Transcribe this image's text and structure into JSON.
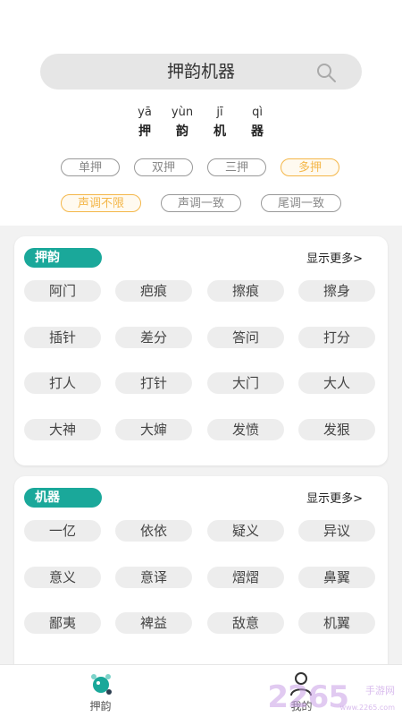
{
  "search": {
    "query": "押韵机器"
  },
  "pinyin": [
    {
      "py": "yā",
      "hz": "押"
    },
    {
      "py": "yùn",
      "hz": "韵"
    },
    {
      "py": "jī",
      "hz": "机"
    },
    {
      "py": "qì",
      "hz": "器"
    }
  ],
  "filters": {
    "rhyme_type": [
      "单押",
      "双押",
      "三押",
      "多押"
    ],
    "rhyme_type_selected": "多押",
    "tone": [
      "声调不限",
      "声调一致",
      "尾调一致"
    ],
    "tone_selected": "声调不限"
  },
  "cards": [
    {
      "tag": "押韵",
      "more": "显示更多>",
      "words": [
        "阿门",
        "疤痕",
        "擦痕",
        "擦身",
        "插针",
        "差分",
        "答问",
        "打分",
        "打人",
        "打针",
        "大门",
        "大人",
        "大神",
        "大婶",
        "发愤",
        "发狠"
      ]
    },
    {
      "tag": "机器",
      "more": "显示更多>",
      "words": [
        "一亿",
        "依依",
        "疑义",
        "异议",
        "意义",
        "意译",
        "熠熠",
        "鼻翼",
        "鄙夷",
        "裨益",
        "敌意",
        "机翼"
      ]
    }
  ],
  "nav": [
    {
      "label": "押韵",
      "icon": "rhyme-icon"
    },
    {
      "label": "我的",
      "icon": "profile-icon"
    }
  ],
  "watermark": {
    "text": "2265.com",
    "cn": "手游网",
    "url": "www.2265.com"
  }
}
